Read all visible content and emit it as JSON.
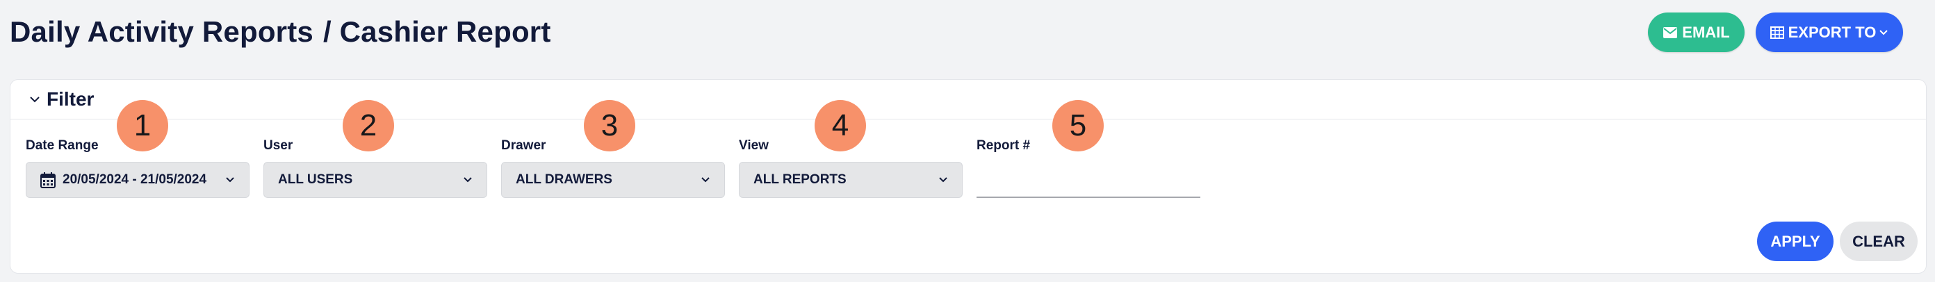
{
  "header": {
    "title": "Daily Activity Reports",
    "separator": "/",
    "subtitle": "Cashier Report"
  },
  "actions": {
    "email_label": "EMAIL",
    "export_label": "EXPORT TO",
    "email_color": "#2dbd90",
    "export_color": "#2f62f5"
  },
  "filter": {
    "title": "Filter",
    "fields": [
      {
        "label": "Date Range",
        "value": "20/05/2024 - 21/05/2024",
        "icon": "calendar-icon"
      },
      {
        "label": "User",
        "value": "ALL USERS"
      },
      {
        "label": "Drawer",
        "value": "ALL DRAWERS"
      },
      {
        "label": "View",
        "value": "ALL REPORTS"
      },
      {
        "label": "Report #",
        "value": ""
      }
    ],
    "apply_label": "APPLY",
    "clear_label": "CLEAR"
  },
  "badges": [
    "1",
    "2",
    "3",
    "4",
    "5"
  ]
}
